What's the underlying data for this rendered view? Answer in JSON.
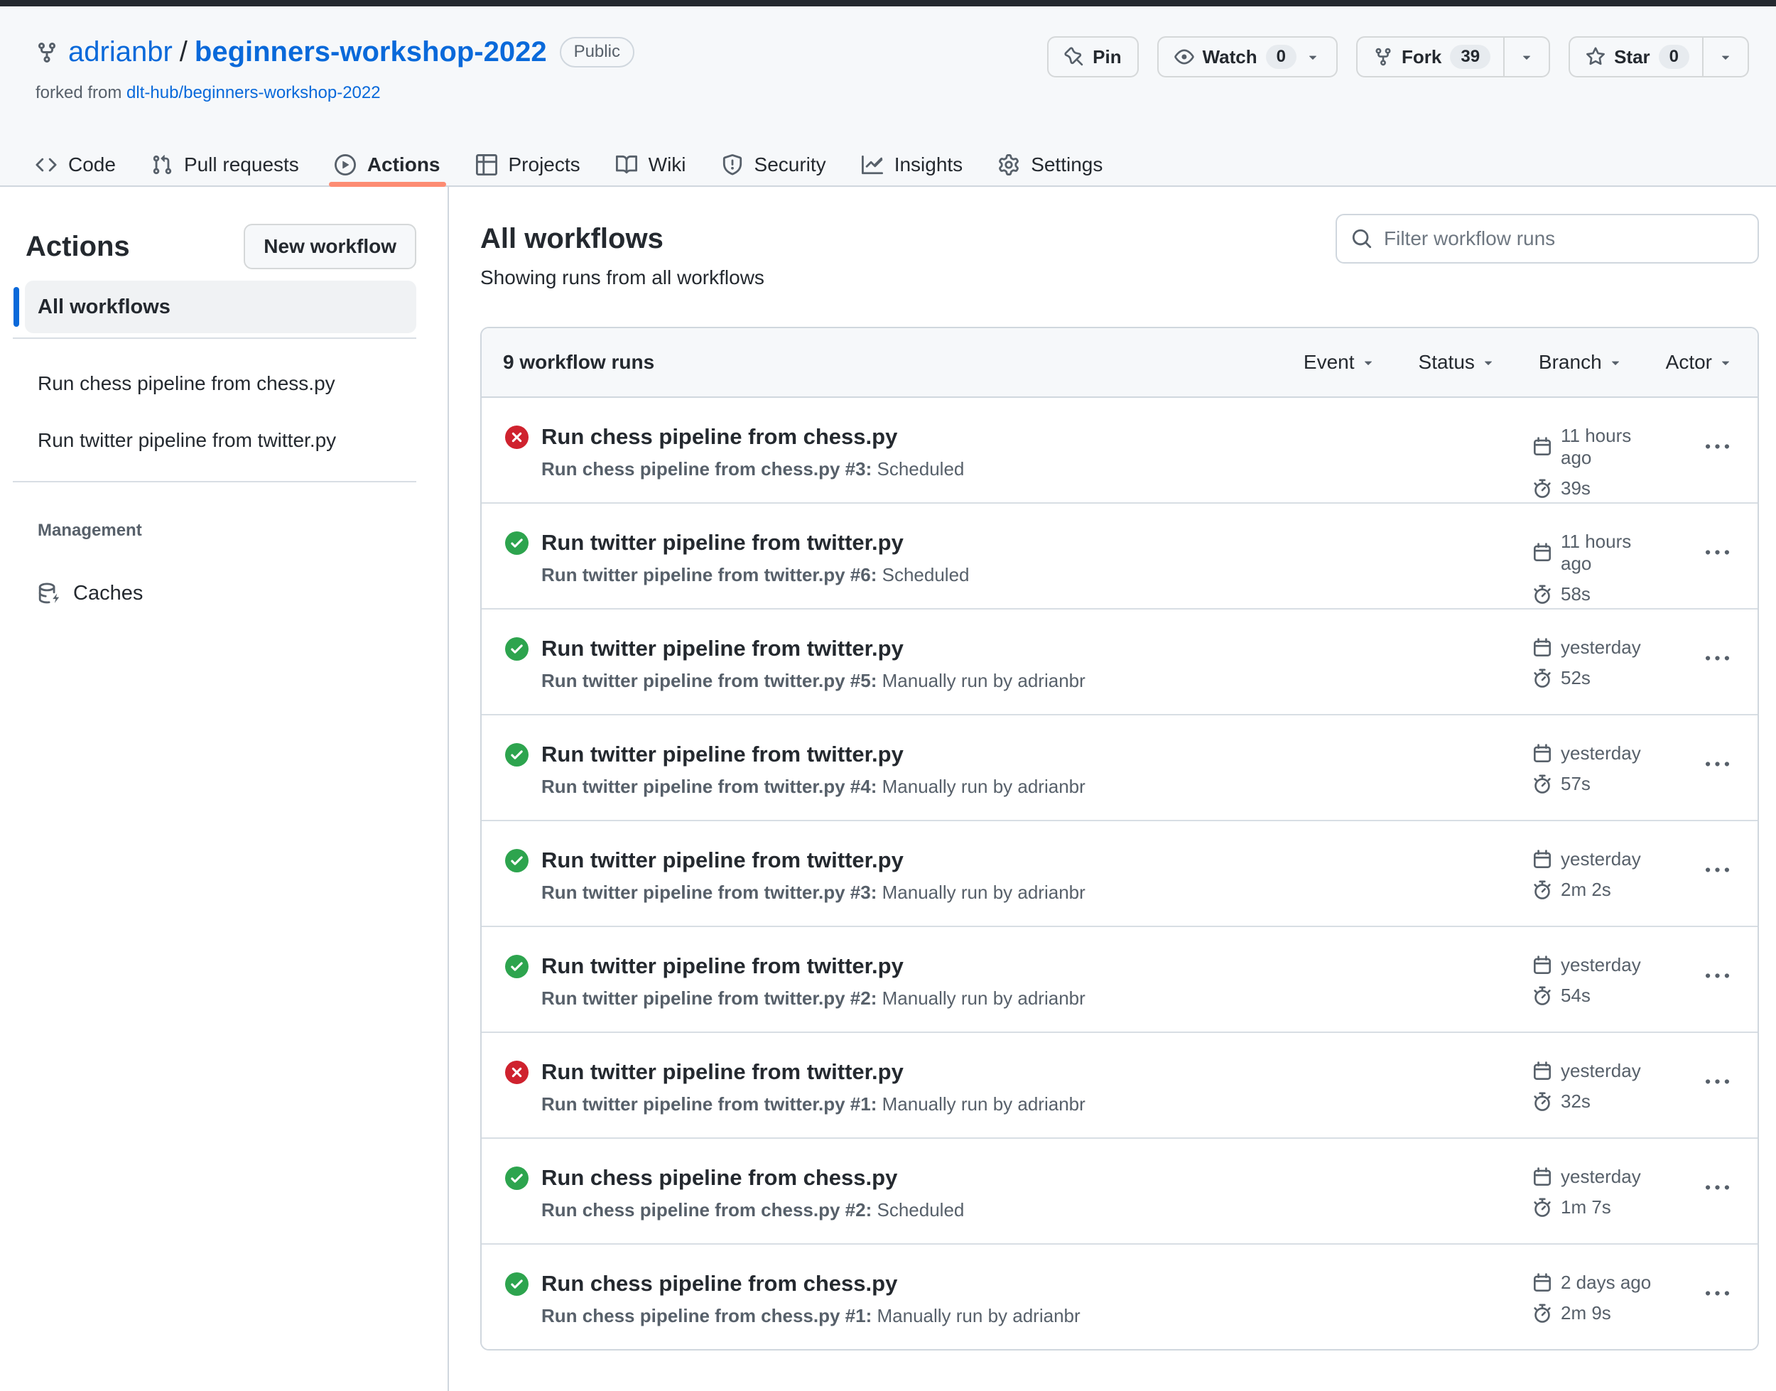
{
  "colors": {
    "accent_blue": "#0969da",
    "success_green": "#2da44e",
    "danger_red": "#cf222e",
    "tab_underline": "#fd8c73",
    "header_bg": "#f6f8fa",
    "border": "#d0d7de",
    "divider": "#d8dee4",
    "text": "#24292f",
    "muted": "#57606a",
    "dark_bar": "#24292f"
  },
  "repo_header": {
    "owner": "adrianbr",
    "separator": "/",
    "name": "beginners-workshop-2022",
    "visibility": "Public",
    "forked_from_label": "forked from",
    "forked_from_link": "dlt-hub/beginners-workshop-2022",
    "action_buttons": [
      {
        "label": "Pin",
        "icon": "pin"
      },
      {
        "label": "Watch",
        "icon": "eye",
        "count": "0",
        "caret": "inline"
      },
      {
        "label": "Fork",
        "icon": "repo-forked",
        "count": "39",
        "caret": "split"
      },
      {
        "label": "Star",
        "icon": "star",
        "count": "0",
        "caret": "split"
      }
    ]
  },
  "nav_tabs": [
    {
      "label": "Code",
      "icon": "code",
      "active": false
    },
    {
      "label": "Pull requests",
      "icon": "git-pull-request",
      "active": false
    },
    {
      "label": "Actions",
      "icon": "play",
      "active": true
    },
    {
      "label": "Projects",
      "icon": "table",
      "active": false
    },
    {
      "label": "Wiki",
      "icon": "book",
      "active": false
    },
    {
      "label": "Security",
      "icon": "shield",
      "active": false
    },
    {
      "label": "Insights",
      "icon": "graph",
      "active": false
    },
    {
      "label": "Settings",
      "icon": "gear",
      "active": false
    }
  ],
  "sidebar": {
    "title": "Actions",
    "new_workflow_button": "New workflow",
    "selected_item": "All workflows",
    "workflows": [
      "Run chess pipeline from chess.py",
      "Run twitter pipeline from twitter.py"
    ],
    "management_label": "Management",
    "management_items": [
      {
        "label": "Caches",
        "icon": "cache"
      }
    ]
  },
  "main": {
    "title": "All workflows",
    "subtitle": "Showing runs from all workflows",
    "filter_placeholder": "Filter workflow runs",
    "table": {
      "count_label": "9 workflow runs",
      "filters": [
        "Event",
        "Status",
        "Branch",
        "Actor"
      ],
      "runs": [
        {
          "status": "failure",
          "title": "Run chess pipeline from chess.py",
          "run_name": "Run chess pipeline from chess.py #3:",
          "run_detail": " Scheduled",
          "time": "11 hours ago",
          "duration": "39s"
        },
        {
          "status": "success",
          "title": "Run twitter pipeline from twitter.py",
          "run_name": "Run twitter pipeline from twitter.py #6:",
          "run_detail": " Scheduled",
          "time": "11 hours ago",
          "duration": "58s"
        },
        {
          "status": "success",
          "title": "Run twitter pipeline from twitter.py",
          "run_name": "Run twitter pipeline from twitter.py #5:",
          "run_detail": " Manually run by adrianbr",
          "time": "yesterday",
          "duration": "52s"
        },
        {
          "status": "success",
          "title": "Run twitter pipeline from twitter.py",
          "run_name": "Run twitter pipeline from twitter.py #4:",
          "run_detail": " Manually run by adrianbr",
          "time": "yesterday",
          "duration": "57s"
        },
        {
          "status": "success",
          "title": "Run twitter pipeline from twitter.py",
          "run_name": "Run twitter pipeline from twitter.py #3:",
          "run_detail": " Manually run by adrianbr",
          "time": "yesterday",
          "duration": "2m 2s"
        },
        {
          "status": "success",
          "title": "Run twitter pipeline from twitter.py",
          "run_name": "Run twitter pipeline from twitter.py #2:",
          "run_detail": " Manually run by adrianbr",
          "time": "yesterday",
          "duration": "54s"
        },
        {
          "status": "failure",
          "title": "Run twitter pipeline from twitter.py",
          "run_name": "Run twitter pipeline from twitter.py #1:",
          "run_detail": " Manually run by adrianbr",
          "time": "yesterday",
          "duration": "32s"
        },
        {
          "status": "success",
          "title": "Run chess pipeline from chess.py",
          "run_name": "Run chess pipeline from chess.py #2:",
          "run_detail": " Scheduled",
          "time": "yesterday",
          "duration": "1m 7s"
        },
        {
          "status": "success",
          "title": "Run chess pipeline from chess.py",
          "run_name": "Run chess pipeline from chess.py #1:",
          "run_detail": " Manually run by adrianbr",
          "time": "2 days ago",
          "duration": "2m 9s"
        }
      ]
    }
  }
}
